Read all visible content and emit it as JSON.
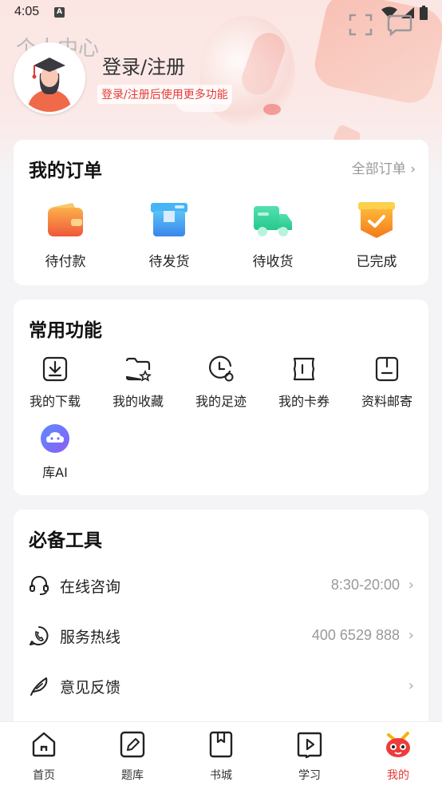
{
  "status_bar": {
    "time": "4:05",
    "sim": "A"
  },
  "header": {
    "title": "个人中心",
    "login_title": "登录/注册",
    "login_subtitle": "登录/注册后使用更多功能"
  },
  "orders": {
    "title": "我的订单",
    "all_label": "全部订单 ›",
    "items": [
      {
        "label": "待付款",
        "icon": "wallet-icon"
      },
      {
        "label": "待发货",
        "icon": "box-icon"
      },
      {
        "label": "待收货",
        "icon": "truck-icon"
      },
      {
        "label": "已完成",
        "icon": "check-package-icon"
      }
    ]
  },
  "functions": {
    "title": "常用功能",
    "items": [
      {
        "label": "我的下载",
        "icon": "download-icon"
      },
      {
        "label": "我的收藏",
        "icon": "folder-star-icon"
      },
      {
        "label": "我的足迹",
        "icon": "clock-icon"
      },
      {
        "label": "我的卡券",
        "icon": "ticket-icon"
      },
      {
        "label": "资料邮寄",
        "icon": "mail-box-icon"
      },
      {
        "label": "库AI",
        "icon": "ai-cloud-icon"
      }
    ]
  },
  "tools": {
    "title": "必备工具",
    "items": [
      {
        "label": "在线咨询",
        "value": "8:30-20:00",
        "icon": "headset-icon"
      },
      {
        "label": "服务热线",
        "value": "400 6529 888",
        "icon": "phone-icon"
      },
      {
        "label": "意见反馈",
        "value": "",
        "icon": "feather-icon"
      }
    ]
  },
  "tabbar": {
    "items": [
      {
        "label": "首页",
        "icon": "home-icon"
      },
      {
        "label": "题库",
        "icon": "edit-icon"
      },
      {
        "label": "书城",
        "icon": "book-icon"
      },
      {
        "label": "学习",
        "icon": "play-book-icon"
      },
      {
        "label": "我的",
        "icon": "mascot-icon"
      }
    ],
    "active_index": 4
  },
  "colors": {
    "accent": "#e53935",
    "background": "#f4f4f6"
  }
}
